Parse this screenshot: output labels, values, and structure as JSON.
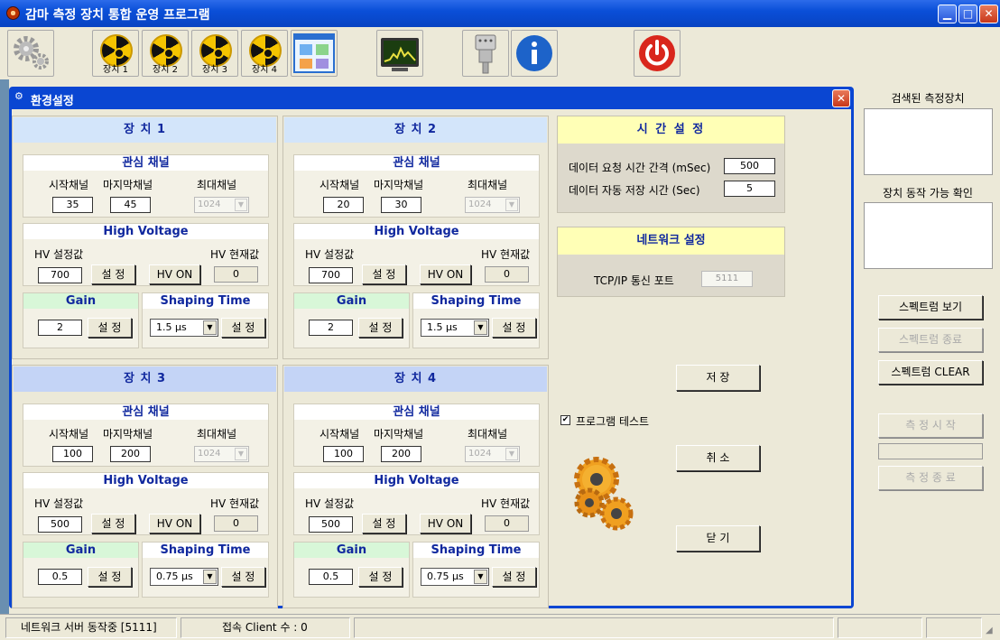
{
  "window": {
    "title": "감마 측정 장치 통합 운영 프로그램",
    "min_icon": "minimize-icon",
    "max_icon": "maximize-icon",
    "close_icon": "close-icon"
  },
  "toolbar": {
    "buttons": [
      {
        "icon": "settings-gear-icon",
        "label": ""
      },
      {
        "icon": "radiation-icon",
        "label": "장치 1"
      },
      {
        "icon": "radiation-icon",
        "label": "장치 2"
      },
      {
        "icon": "radiation-icon",
        "label": "장치 3"
      },
      {
        "icon": "radiation-icon",
        "label": "장치 4"
      },
      {
        "icon": "grid-view-icon",
        "label": ""
      },
      {
        "icon": "spectrum-monitor-icon",
        "label": ""
      },
      {
        "icon": "serial-port-icon",
        "label": ""
      },
      {
        "icon": "info-icon",
        "label": ""
      },
      {
        "icon": "power-icon",
        "label": ""
      }
    ]
  },
  "dialog": {
    "title": "환경설정",
    "close_icon": "close-icon"
  },
  "devices": [
    {
      "name": "장 치 1",
      "interest_title": "관심 채널",
      "start_label": "시작채널",
      "end_label": "마지막채널",
      "max_label": "최대채널",
      "start": "35",
      "end": "45",
      "max": "1024",
      "hv_title": "High Voltage",
      "hv_set_label": "HV 설정값",
      "hv_cur_label": "HV 현재값",
      "hv_value": "700",
      "hv_set_btn": "설 정",
      "hv_on_btn": "HV ON",
      "hv_current": "0",
      "gain_title": "Gain",
      "gain": "2",
      "gain_btn": "설 정",
      "shaping_title": "Shaping Time",
      "shaping": "1.5  µs",
      "shaping_btn": "설 정"
    },
    {
      "name": "장 치 2",
      "interest_title": "관심 채널",
      "start_label": "시작채널",
      "end_label": "마지막채널",
      "max_label": "최대채널",
      "start": "20",
      "end": "30",
      "max": "1024",
      "hv_title": "High Voltage",
      "hv_set_label": "HV 설정값",
      "hv_cur_label": "HV 현재값",
      "hv_value": "700",
      "hv_set_btn": "설 정",
      "hv_on_btn": "HV ON",
      "hv_current": "0",
      "gain_title": "Gain",
      "gain": "2",
      "gain_btn": "설 정",
      "shaping_title": "Shaping Time",
      "shaping": "1.5  µs",
      "shaping_btn": "설 정"
    },
    {
      "name": "장 치 3",
      "interest_title": "관심 채널",
      "start_label": "시작채널",
      "end_label": "마지막채널",
      "max_label": "최대채널",
      "start": "100",
      "end": "200",
      "max": "1024",
      "hv_title": "High Voltage",
      "hv_set_label": "HV 설정값",
      "hv_cur_label": "HV 현재값",
      "hv_value": "500",
      "hv_set_btn": "설 정",
      "hv_on_btn": "HV ON",
      "hv_current": "0",
      "gain_title": "Gain",
      "gain": "0.5",
      "gain_btn": "설 정",
      "shaping_title": "Shaping Time",
      "shaping": "0.75  µs",
      "shaping_btn": "설 정"
    },
    {
      "name": "장 치 4",
      "interest_title": "관심 채널",
      "start_label": "시작채널",
      "end_label": "마지막채널",
      "max_label": "최대채널",
      "start": "100",
      "end": "200",
      "max": "1024",
      "hv_title": "High Voltage",
      "hv_set_label": "HV 설정값",
      "hv_cur_label": "HV 현재값",
      "hv_value": "500",
      "hv_set_btn": "설 정",
      "hv_on_btn": "HV ON",
      "hv_current": "0",
      "gain_title": "Gain",
      "gain": "0.5",
      "gain_btn": "설 정",
      "shaping_title": "Shaping Time",
      "shaping": "0.75  µs",
      "shaping_btn": "설 정"
    }
  ],
  "time_settings": {
    "title": "시 간 설 정",
    "request_label": "데이터 요청 시간 간격 (mSec)",
    "request_value": "500",
    "autosave_label": "데이터 자동 저장 시간 (Sec)",
    "autosave_value": "5"
  },
  "network": {
    "title": "네트워크 설정",
    "port_label": "TCP/IP 통신 포트",
    "port_value": "5111"
  },
  "actions": {
    "save": "저  장",
    "cancel": "취  소",
    "close": "닫  기"
  },
  "program_test": {
    "label": "프로그램 테스트",
    "checked": true
  },
  "right_panel": {
    "found_devices": "검색된 측정장치",
    "device_check": "장치 동작 가능 확인",
    "spectrum_view": "스펙트럼 보기",
    "spectrum_end": "스펙트럼 종료",
    "spectrum_clear": "스펙트럼 CLEAR",
    "measure_start": "측  정  시  작",
    "measure_end": "측  정  종  료"
  },
  "status": {
    "network": "네트워크 서버 동작중 [5111]",
    "clients": "접속 Client 수 : 0"
  },
  "colors": {
    "titlebar": "#0a4fd8",
    "header_blue": "#10289e",
    "device_head": "#d3e5fa",
    "panel_head": "#ffffb6",
    "gain_head": "#d8f7d8"
  }
}
